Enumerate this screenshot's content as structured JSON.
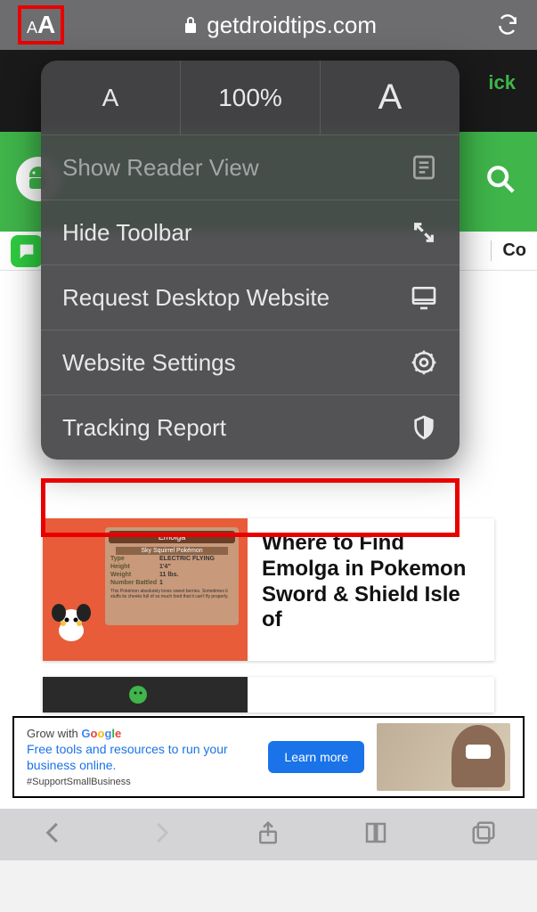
{
  "url_bar": {
    "domain": "getdroidtips.com"
  },
  "band": {
    "ick": "ick",
    "co": "Co"
  },
  "menu": {
    "zoom_pct": "100%",
    "items": [
      {
        "label": "Show Reader View",
        "icon": "reader"
      },
      {
        "label": "Hide Toolbar",
        "icon": "expand"
      },
      {
        "label": "Request Desktop Website",
        "icon": "monitor"
      },
      {
        "label": "Website Settings",
        "icon": "gear"
      },
      {
        "label": "Tracking Report",
        "icon": "shield"
      }
    ]
  },
  "card": {
    "title": "Where to Find Emolga in Pokemon Sword & Shield Isle of",
    "poke": {
      "name": "Emolga",
      "sub": "Sky Squirrel Pokémon",
      "rows": [
        {
          "k": "Type",
          "v": "ELECTRIC FLYING"
        },
        {
          "k": "Height",
          "v": "1'4\""
        },
        {
          "k": "Weight",
          "v": "11 lbs."
        },
        {
          "k": "Number Battled",
          "v": "1"
        }
      ],
      "desc": "This Pokémon absolutely loves sweet berries. Sometimes it stuffs its cheeks full of so much food that it can't fly properly."
    }
  },
  "ad": {
    "grow": "Grow with",
    "line": "Free tools and resources to run your business online.",
    "hash": "#SupportSmallBusiness",
    "btn": "Learn more"
  }
}
